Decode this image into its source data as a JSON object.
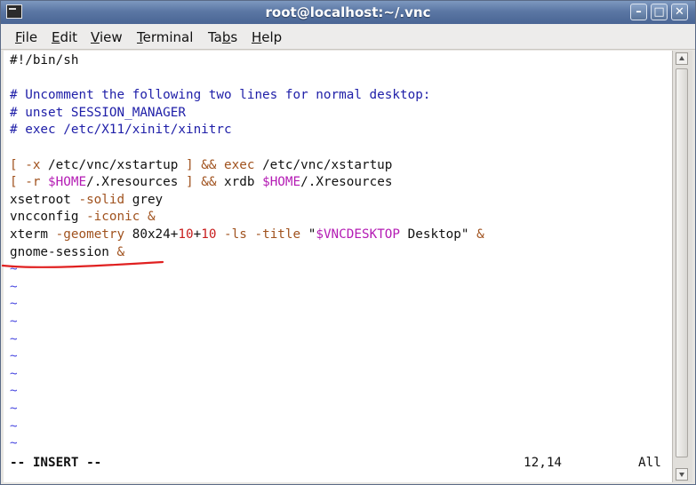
{
  "window": {
    "title": "root@localhost:~/.vnc",
    "buttons": {
      "minimize": "–",
      "maximize": "□",
      "close": "✕"
    }
  },
  "menu": [
    {
      "pre": "",
      "u": "F",
      "post": "ile"
    },
    {
      "pre": "",
      "u": "E",
      "post": "dit"
    },
    {
      "pre": "",
      "u": "V",
      "post": "iew"
    },
    {
      "pre": "",
      "u": "T",
      "post": "erminal"
    },
    {
      "pre": "Ta",
      "u": "b",
      "post": "s"
    },
    {
      "pre": "",
      "u": "H",
      "post": "elp"
    }
  ],
  "editor": {
    "lines": [
      {
        "segments": [
          {
            "t": "#!/bin/sh",
            "c": "plain"
          }
        ]
      },
      {
        "segments": []
      },
      {
        "segments": [
          {
            "t": "# Uncomment the following two lines for normal desktop:",
            "c": "comment"
          }
        ]
      },
      {
        "segments": [
          {
            "t": "# unset SESSION_MANAGER",
            "c": "comment"
          }
        ]
      },
      {
        "segments": [
          {
            "t": "# exec /etc/X11/xinit/xinitrc",
            "c": "comment"
          }
        ]
      },
      {
        "segments": []
      },
      {
        "segments": [
          {
            "t": "[ -x ",
            "c": "brown"
          },
          {
            "t": "/etc/vnc/xstartup ",
            "c": "plain"
          },
          {
            "t": "] && exec ",
            "c": "brown"
          },
          {
            "t": "/etc/vnc/xstartup",
            "c": "plain"
          }
        ]
      },
      {
        "segments": [
          {
            "t": "[ -r ",
            "c": "brown"
          },
          {
            "t": "$HOME",
            "c": "mag"
          },
          {
            "t": "/.Xresources ",
            "c": "plain"
          },
          {
            "t": "] && ",
            "c": "brown"
          },
          {
            "t": "xrdb ",
            "c": "plain"
          },
          {
            "t": "$HOME",
            "c": "mag"
          },
          {
            "t": "/.Xresources",
            "c": "plain"
          }
        ]
      },
      {
        "segments": [
          {
            "t": "xsetroot ",
            "c": "plain"
          },
          {
            "t": "-solid ",
            "c": "brown"
          },
          {
            "t": "grey",
            "c": "plain"
          }
        ]
      },
      {
        "segments": [
          {
            "t": "vncconfig ",
            "c": "plain"
          },
          {
            "t": "-iconic ",
            "c": "brown"
          },
          {
            "t": "&",
            "c": "brown"
          }
        ]
      },
      {
        "segments": [
          {
            "t": "xterm ",
            "c": "plain"
          },
          {
            "t": "-geometry ",
            "c": "brown"
          },
          {
            "t": "80x24+",
            "c": "plain"
          },
          {
            "t": "10",
            "c": "red"
          },
          {
            "t": "+",
            "c": "plain"
          },
          {
            "t": "10",
            "c": "red"
          },
          {
            "t": " -ls -title ",
            "c": "brown"
          },
          {
            "t": "\"",
            "c": "plain"
          },
          {
            "t": "$VNCDESKTOP",
            "c": "mag"
          },
          {
            "t": " Desktop",
            "c": "plain"
          },
          {
            "t": "\"",
            "c": "plain"
          },
          {
            "t": " &",
            "c": "brown"
          }
        ]
      },
      {
        "segments": [
          {
            "t": "gnome-session ",
            "c": "plain"
          },
          {
            "t": "&",
            "c": "brown"
          }
        ]
      }
    ],
    "tilde_rows": 11,
    "tilde_char": "~",
    "status": {
      "mode": "-- INSERT --",
      "position": "12,14",
      "scroll": "All"
    }
  },
  "annotation": {
    "type": "underline",
    "target_line": 12,
    "color": "#e02020"
  }
}
